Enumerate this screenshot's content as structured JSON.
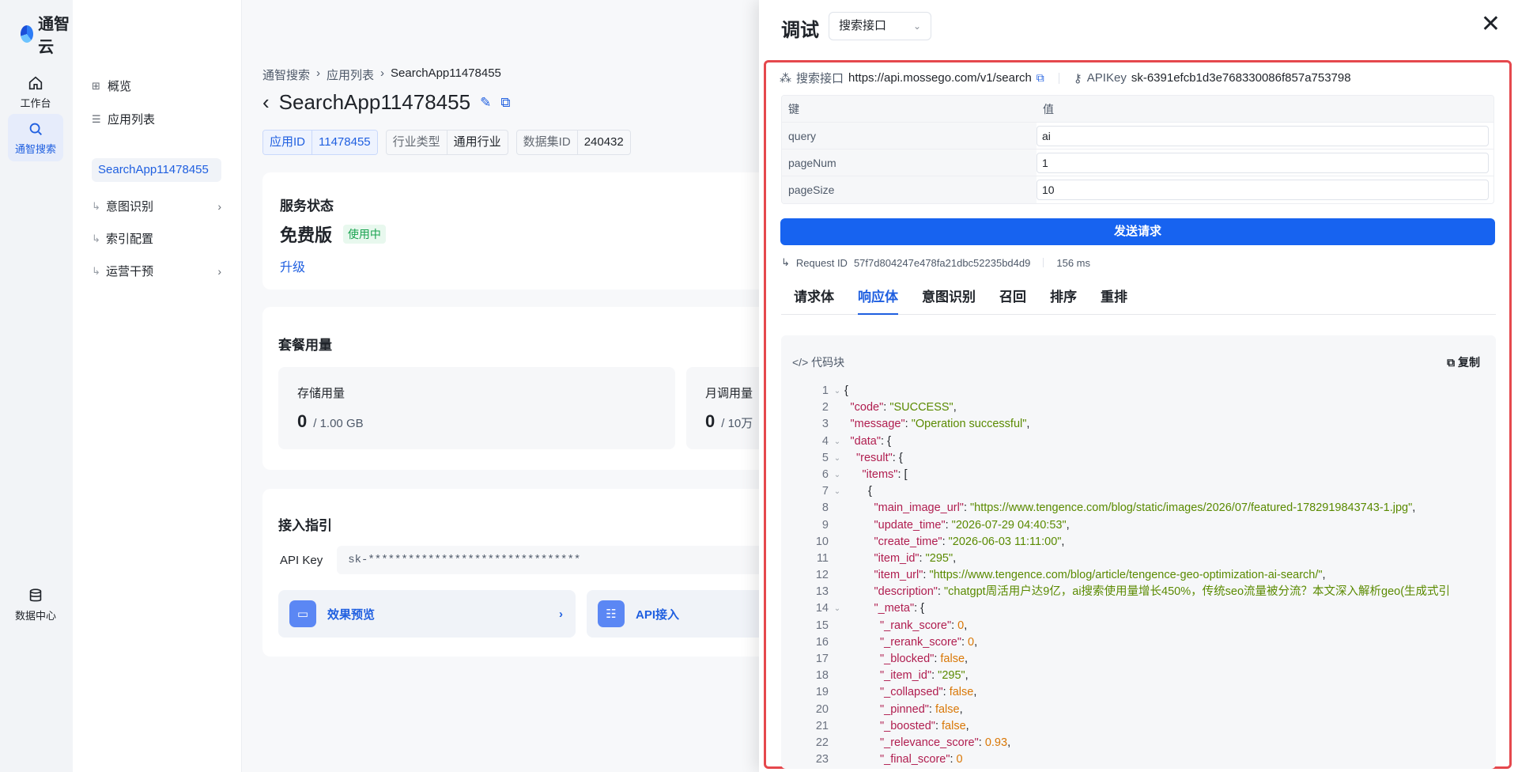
{
  "brand": {
    "name": "通智云"
  },
  "rail": {
    "items": [
      {
        "label": "工作台"
      },
      {
        "label": "通智搜索"
      },
      {
        "label": "数据中心"
      }
    ]
  },
  "subnav": {
    "overview": "概览",
    "app_list": "应用列表",
    "current_app": "SearchApp11478455",
    "children": [
      "意图识别",
      "索引配置",
      "运营干预"
    ]
  },
  "breadcrumb": [
    "通智搜索",
    "应用列表",
    "SearchApp11478455"
  ],
  "page_title": "SearchApp11478455",
  "tags": [
    {
      "k": "应用ID",
      "v": "11478455"
    },
    {
      "k": "行业类型",
      "v": "通用行业"
    },
    {
      "k": "数据集ID",
      "v": "240432"
    }
  ],
  "service": {
    "title": "服务状态",
    "plan": "免费版",
    "badge": "使用中",
    "upgrade": "升级"
  },
  "usage": {
    "title": "套餐用量",
    "storage": {
      "label": "存储用量",
      "value": "0",
      "unit": "/ 1.00 GB"
    },
    "monthly": {
      "label": "月调用量",
      "value": "0",
      "unit": "/ 10万"
    }
  },
  "access": {
    "title": "接入指引",
    "api_key_label": "API Key",
    "api_key_value": "sk-********************************",
    "preview": "效果预览",
    "api": "API接入"
  },
  "drawer": {
    "title": "调试",
    "select": "搜索接口",
    "endpoint_label": "搜索接口",
    "endpoint_url": "https://api.mossego.com/v1/search",
    "apikey_label": "APIKey",
    "apikey_value": "sk-6391efcb1d3e768330086f857a753798",
    "params_header": {
      "key": "键",
      "value": "值"
    },
    "params": [
      {
        "key": "query",
        "value": "ai"
      },
      {
        "key": "pageNum",
        "value": "1"
      },
      {
        "key": "pageSize",
        "value": "10"
      }
    ],
    "send": "发送请求",
    "request_id_label": "Request ID",
    "request_id": "57f7d804247e478fa21dbc52235bd4d9",
    "latency": "156 ms",
    "tabs": [
      "请求体",
      "响应体",
      "意图识别",
      "召回",
      "排序",
      "重排"
    ],
    "active_tab": 1,
    "code_label": "代码块",
    "copy_label": "复制"
  },
  "code_lines": [
    {
      "n": "1",
      "f": true,
      "i": 0,
      "parts": [
        [
          "p",
          "{"
        ]
      ]
    },
    {
      "n": "2",
      "f": false,
      "i": 1,
      "parts": [
        [
          "k",
          "\"code\""
        ],
        [
          "p",
          ": "
        ],
        [
          "s",
          "\"SUCCESS\""
        ],
        [
          "p",
          ","
        ]
      ]
    },
    {
      "n": "3",
      "f": false,
      "i": 1,
      "parts": [
        [
          "k",
          "\"message\""
        ],
        [
          "p",
          ": "
        ],
        [
          "s",
          "\"Operation successful\""
        ],
        [
          "p",
          ","
        ]
      ]
    },
    {
      "n": "4",
      "f": true,
      "i": 1,
      "parts": [
        [
          "k",
          "\"data\""
        ],
        [
          "p",
          ": {"
        ]
      ]
    },
    {
      "n": "5",
      "f": true,
      "i": 2,
      "parts": [
        [
          "k",
          "\"result\""
        ],
        [
          "p",
          ": {"
        ]
      ]
    },
    {
      "n": "6",
      "f": true,
      "i": 3,
      "parts": [
        [
          "k",
          "\"items\""
        ],
        [
          "p",
          ": ["
        ]
      ]
    },
    {
      "n": "7",
      "f": true,
      "i": 4,
      "parts": [
        [
          "p",
          "{"
        ]
      ]
    },
    {
      "n": "8",
      "f": false,
      "i": 5,
      "parts": [
        [
          "k",
          "\"main_image_url\""
        ],
        [
          "p",
          ": "
        ],
        [
          "s",
          "\"https://www.tengence.com/blog/static/images/2026/07/featured-1782919843743-1.jpg\""
        ],
        [
          "p",
          ","
        ]
      ]
    },
    {
      "n": "9",
      "f": false,
      "i": 5,
      "parts": [
        [
          "k",
          "\"update_time\""
        ],
        [
          "p",
          ": "
        ],
        [
          "s",
          "\"2026-07-29 04:40:53\""
        ],
        [
          "p",
          ","
        ]
      ]
    },
    {
      "n": "10",
      "f": false,
      "i": 5,
      "parts": [
        [
          "k",
          "\"create_time\""
        ],
        [
          "p",
          ": "
        ],
        [
          "s",
          "\"2026-06-03 11:11:00\""
        ],
        [
          "p",
          ","
        ]
      ]
    },
    {
      "n": "11",
      "f": false,
      "i": 5,
      "parts": [
        [
          "k",
          "\"item_id\""
        ],
        [
          "p",
          ": "
        ],
        [
          "s",
          "\"295\""
        ],
        [
          "p",
          ","
        ]
      ]
    },
    {
      "n": "12",
      "f": false,
      "i": 5,
      "parts": [
        [
          "k",
          "\"item_url\""
        ],
        [
          "p",
          ": "
        ],
        [
          "s",
          "\"https://www.tengence.com/blog/article/tengence-geo-optimization-ai-search/\""
        ],
        [
          "p",
          ","
        ]
      ]
    },
    {
      "n": "13",
      "f": false,
      "i": 5,
      "parts": [
        [
          "k",
          "\"description\""
        ],
        [
          "p",
          ": "
        ],
        [
          "s",
          "\"chatgpt周活用户达9亿，ai搜索使用量增长450%，传统seo流量被分流？本文深入解析geo(生成式引"
        ]
      ]
    },
    {
      "n": "14",
      "f": true,
      "i": 5,
      "parts": [
        [
          "k",
          "\"_meta\""
        ],
        [
          "p",
          ": {"
        ]
      ]
    },
    {
      "n": "15",
      "f": false,
      "i": 6,
      "parts": [
        [
          "k",
          "\"_rank_score\""
        ],
        [
          "p",
          ": "
        ],
        [
          "v",
          "0"
        ],
        [
          "p",
          ","
        ]
      ]
    },
    {
      "n": "16",
      "f": false,
      "i": 6,
      "parts": [
        [
          "k",
          "\"_rerank_score\""
        ],
        [
          "p",
          ": "
        ],
        [
          "v",
          "0"
        ],
        [
          "p",
          ","
        ]
      ]
    },
    {
      "n": "17",
      "f": false,
      "i": 6,
      "parts": [
        [
          "k",
          "\"_blocked\""
        ],
        [
          "p",
          ": "
        ],
        [
          "v",
          "false"
        ],
        [
          "p",
          ","
        ]
      ]
    },
    {
      "n": "18",
      "f": false,
      "i": 6,
      "parts": [
        [
          "k",
          "\"_item_id\""
        ],
        [
          "p",
          ": "
        ],
        [
          "s",
          "\"295\""
        ],
        [
          "p",
          ","
        ]
      ]
    },
    {
      "n": "19",
      "f": false,
      "i": 6,
      "parts": [
        [
          "k",
          "\"_collapsed\""
        ],
        [
          "p",
          ": "
        ],
        [
          "v",
          "false"
        ],
        [
          "p",
          ","
        ]
      ]
    },
    {
      "n": "20",
      "f": false,
      "i": 6,
      "parts": [
        [
          "k",
          "\"_pinned\""
        ],
        [
          "p",
          ": "
        ],
        [
          "v",
          "false"
        ],
        [
          "p",
          ","
        ]
      ]
    },
    {
      "n": "21",
      "f": false,
      "i": 6,
      "parts": [
        [
          "k",
          "\"_boosted\""
        ],
        [
          "p",
          ": "
        ],
        [
          "v",
          "false"
        ],
        [
          "p",
          ","
        ]
      ]
    },
    {
      "n": "22",
      "f": false,
      "i": 6,
      "parts": [
        [
          "k",
          "\"_relevance_score\""
        ],
        [
          "p",
          ": "
        ],
        [
          "v",
          "0.93"
        ],
        [
          "p",
          ","
        ]
      ]
    },
    {
      "n": "23",
      "f": false,
      "i": 6,
      "parts": [
        [
          "k",
          "\"_final_score\""
        ],
        [
          "p",
          ": "
        ],
        [
          "v",
          "0"
        ]
      ]
    }
  ]
}
